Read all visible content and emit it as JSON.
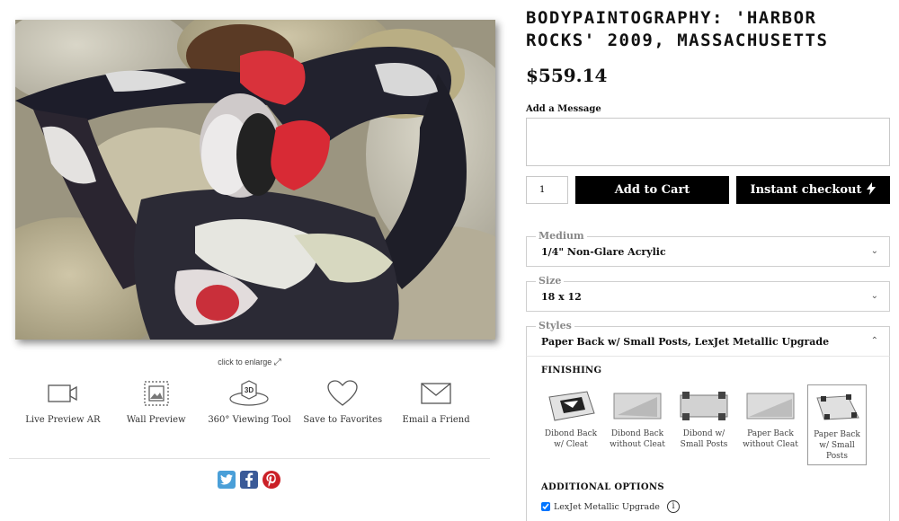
{
  "product": {
    "title": "BODYPAINTOGRAPHY: 'HARBOR ROCKS' 2009, MASSACHUSETTS",
    "price": "$559.14"
  },
  "image": {
    "enlarge_label": "click to enlarge"
  },
  "tools": [
    {
      "label": "Live Preview AR",
      "icon": "video-camera-icon"
    },
    {
      "label": "Wall Preview",
      "icon": "wall-frame-icon"
    },
    {
      "label": "360° Viewing Tool",
      "icon": "cube-3d-icon"
    },
    {
      "label": "Save to Favorites",
      "icon": "heart-icon"
    },
    {
      "label": "Email a Friend",
      "icon": "envelope-icon"
    }
  ],
  "social": [
    {
      "name": "twitter-icon",
      "glyph": "t"
    },
    {
      "name": "facebook-icon",
      "glyph": "f"
    },
    {
      "name": "pinterest-icon",
      "glyph": "p"
    }
  ],
  "message": {
    "label": "Add a Message",
    "value": ""
  },
  "cart": {
    "quantity": "1",
    "add_label": "Add to Cart",
    "checkout_label": "Instant checkout"
  },
  "medium": {
    "legend": "Medium",
    "value": "1/4\" Non-Glare Acrylic"
  },
  "size": {
    "legend": "Size",
    "value": "18 x 12"
  },
  "styles": {
    "legend": "Styles",
    "value": "Paper Back w/ Small Posts, LexJet Metallic Upgrade",
    "finishing_heading": "FINISHING",
    "finishing_options": [
      {
        "label": "Dibond Back w/ Cleat",
        "selected": false
      },
      {
        "label": "Dibond Back without Cleat",
        "selected": false
      },
      {
        "label": "Dibond w/ Small Posts",
        "selected": false
      },
      {
        "label": "Paper Back without Cleat",
        "selected": false
      },
      {
        "label": "Paper Back w/ Small Posts",
        "selected": true
      }
    ],
    "additional_heading": "ADDITIONAL OPTIONS",
    "lexjet_label": "LexJet Metallic Upgrade",
    "lexjet_checked": true
  },
  "colors": {
    "button_bg": "#000000",
    "accent_twitter": "#4a9fd8",
    "accent_facebook": "#3a5a98",
    "accent_pinterest": "#cb2027"
  }
}
